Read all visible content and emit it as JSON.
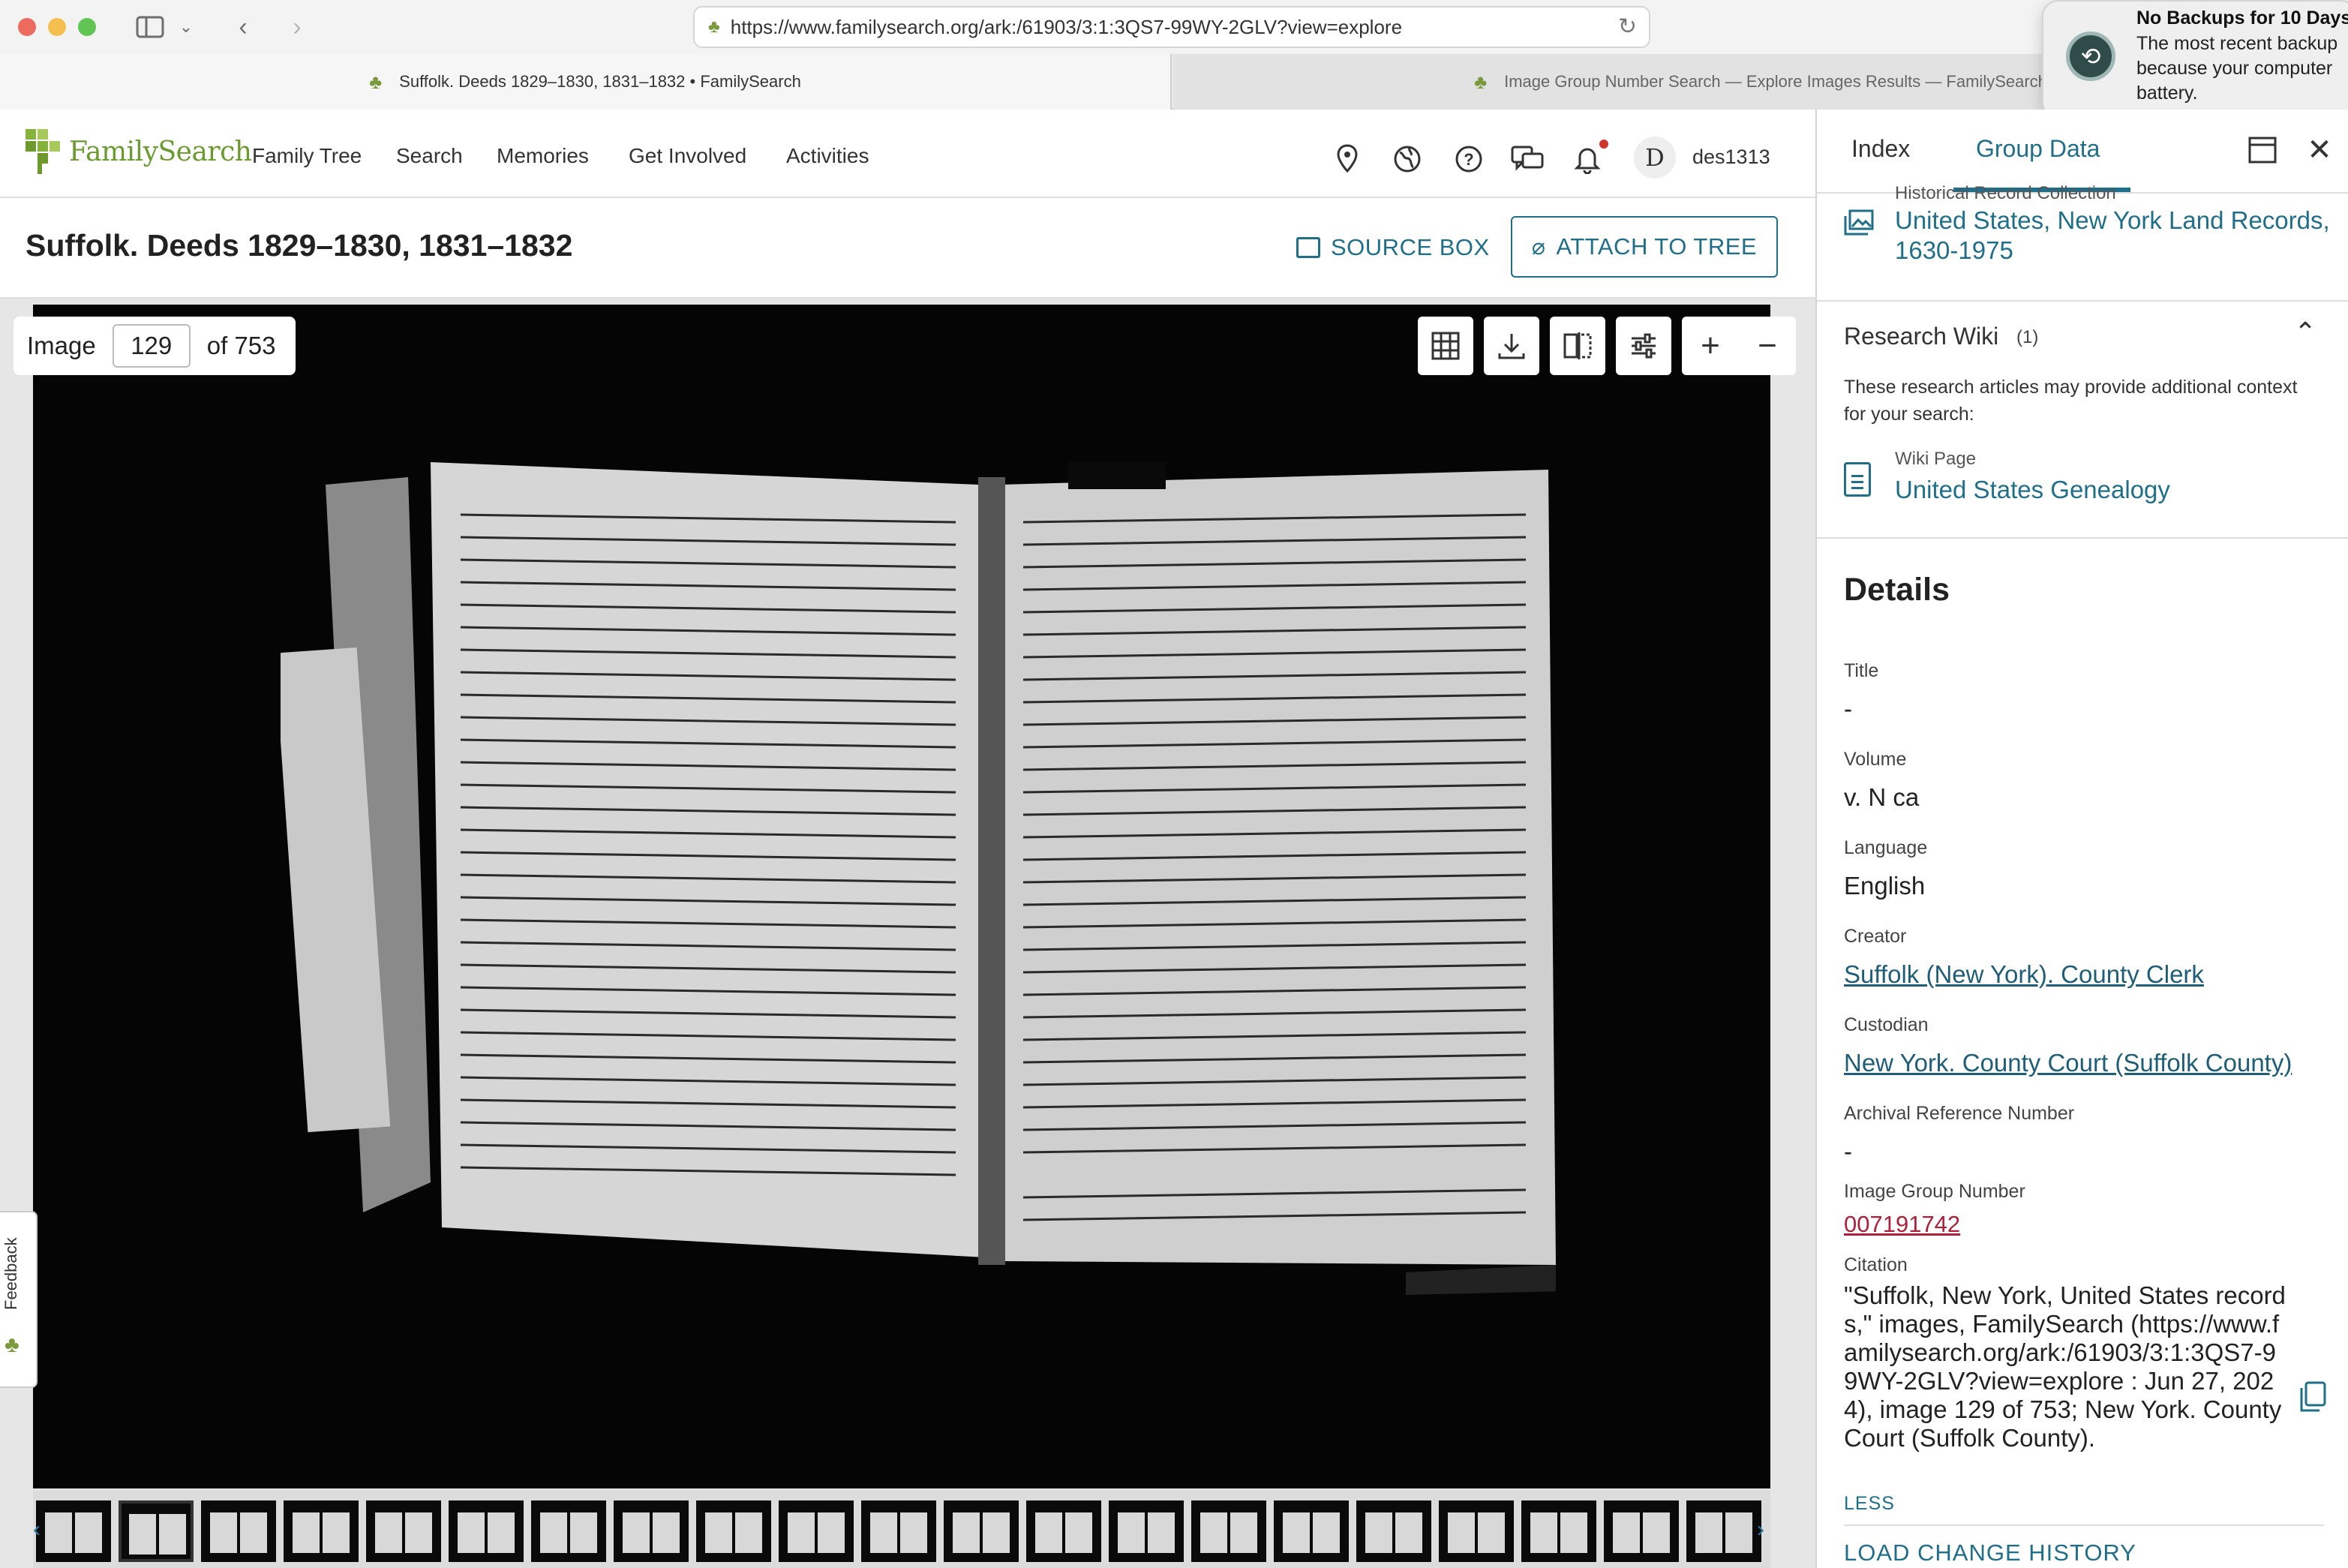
{
  "browser": {
    "url": "https://www.familysearch.org/ark:/61903/3:1:3QS7-99WY-2GLV?view=explore",
    "tabs": [
      {
        "title": "Suffolk. Deeds 1829–1830, 1831–1832 • FamilySearch"
      },
      {
        "title": "Image Group Number Search — Explore Images Results — FamilySearch"
      }
    ]
  },
  "notification": {
    "title": "No Backups for 10 Days",
    "body": "The most recent backup\nbecause your computer\nbattery."
  },
  "header": {
    "logo": "FamilySearch",
    "nav": [
      "Family Tree",
      "Search",
      "Memories",
      "Get Involved",
      "Activities"
    ],
    "icons": [
      "location-pin-icon",
      "globe-icon",
      "help-icon",
      "chat-icon",
      "bell-icon"
    ],
    "avatar_initial": "D",
    "username": "des1313"
  },
  "title_bar": {
    "title": "Suffolk. Deeds 1829–1830, 1831–1832",
    "source_box": "SOURCE BOX",
    "attach": "ATTACH TO TREE"
  },
  "viewer": {
    "image_label": "Image",
    "image_number": "129",
    "image_total": "of 753",
    "feedback": "Feedback",
    "thumb_count": 21,
    "current_thumb_index": 1
  },
  "panel": {
    "tabs": [
      "Index",
      "Group Data"
    ],
    "active_tab": "Group Data",
    "historical_label": "Historical Record Collection",
    "historical_link": "United States, New York Land Records, 1630-1975",
    "wiki": {
      "title": "Research Wiki",
      "count": "(1)",
      "description": "These research articles may provide additional context for your search:",
      "page_label": "Wiki Page",
      "page_link": "United States Genealogy"
    },
    "details": {
      "heading": "Details",
      "title_label": "Title",
      "title_value": "-",
      "volume_label": "Volume",
      "volume_value": "v. N ca",
      "language_label": "Language",
      "language_value": "English",
      "creator_label": "Creator",
      "creator_value": "Suffolk (New York). County Clerk",
      "custodian_label": "Custodian",
      "custodian_value": "New York. County Court (Suffolk County)",
      "archival_label": "Archival Reference Number",
      "archival_value": "-",
      "group_label": "Image Group Number",
      "group_value": "007191742",
      "citation_label": "Citation",
      "citation_value": "\"Suffolk, New York, United States records,\" images, FamilySearch (https://www.familysearch.org/ark:/61903/3:1:3QS7-99WY-2GLV?view=explore : Jun 27, 2024), image 129 of 753; New York. County Court (Suffolk County).",
      "less": "LESS",
      "load_history": "LOAD CHANGE HISTORY"
    }
  },
  "colors": {
    "brand_green": "#7a9a3c",
    "link_teal": "#1f6f8b",
    "group_number_red": "#b0203a",
    "notification_dot": "#d0342c"
  }
}
